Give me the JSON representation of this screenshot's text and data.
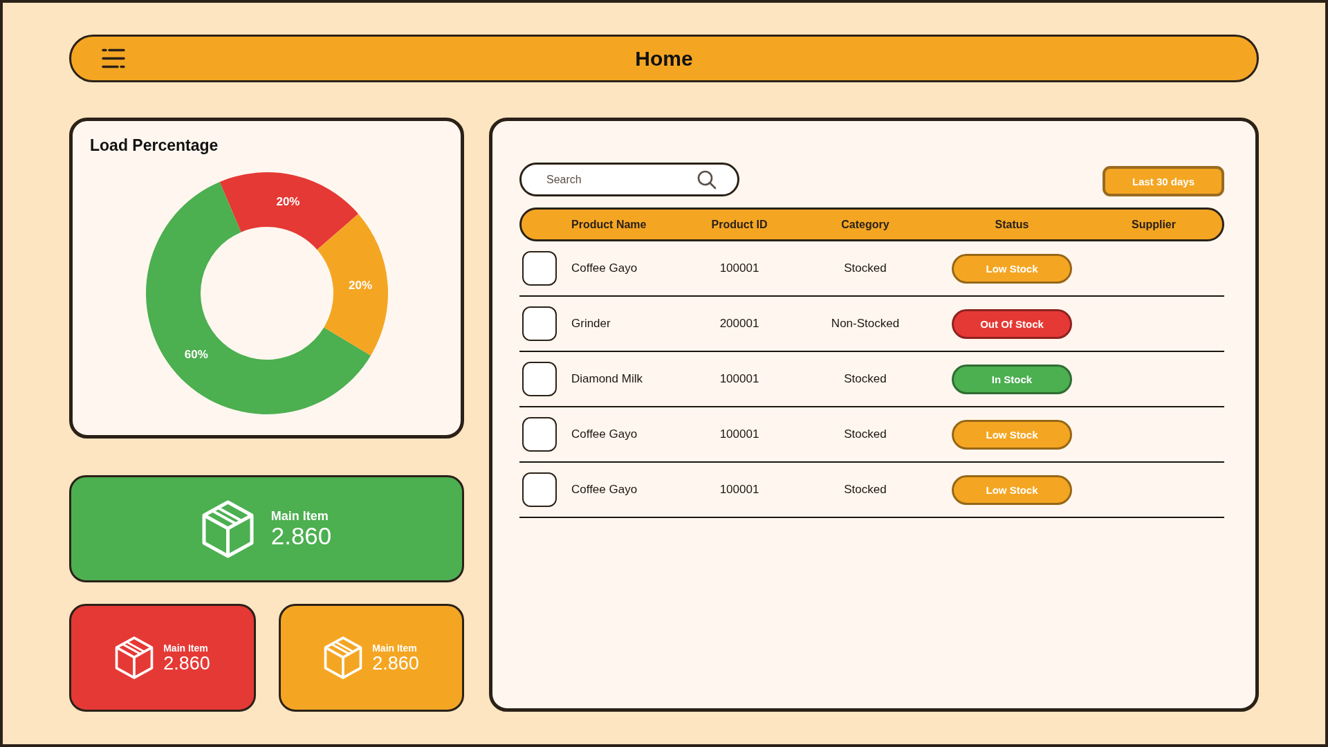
{
  "top_bar": {
    "title": "Home"
  },
  "load_chart": {
    "chart_data": {
      "type": "donut",
      "title": "Load Percentage",
      "values": [
        20,
        20,
        60
      ],
      "colors": [
        "#e53935",
        "#f4a623",
        "#4caf50"
      ],
      "value_labels": [
        "20%",
        "20%",
        "60%"
      ]
    }
  },
  "stats": [
    {
      "kind": "large",
      "label": "Main Item",
      "value": "2.860",
      "color": "#4caf50"
    },
    {
      "kind": "small",
      "label": "Main Item",
      "value": "2.860",
      "color": "#e53935"
    },
    {
      "kind": "small",
      "label": "Main Item",
      "value": "2.860",
      "color": "#f4a623"
    }
  ],
  "inventory": {
    "search": {
      "placeholder": "Search"
    },
    "date_range_button": "Last 30 days",
    "table": {
      "columns": [
        "Product Name",
        "Product ID",
        "Category",
        "Status",
        "Supplier"
      ],
      "rows": [
        {
          "checked": false,
          "product_name": "Coffee Gayo",
          "product_id": "100001",
          "category": "Stocked",
          "status": {
            "label": "Low Stock",
            "color": "#f4a623"
          }
        },
        {
          "checked": false,
          "product_name": "Grinder",
          "product_id": "200001",
          "category": "Non-Stocked",
          "status": {
            "label": "Out Of Stock",
            "color": "#e53935"
          }
        },
        {
          "checked": false,
          "product_name": "Diamond Milk",
          "product_id": "100001",
          "category": "Stocked",
          "status": {
            "label": "In Stock",
            "color": "#4caf50"
          }
        },
        {
          "checked": false,
          "product_name": "Coffee Gayo",
          "product_id": "100001",
          "category": "Stocked",
          "status": {
            "label": "Low Stock",
            "color": "#f4a623"
          }
        },
        {
          "checked": false,
          "product_name": "Coffee Gayo",
          "product_id": "100001",
          "category": "Stocked",
          "status": {
            "label": "Low Stock",
            "color": "#f4a623"
          }
        }
      ]
    }
  }
}
